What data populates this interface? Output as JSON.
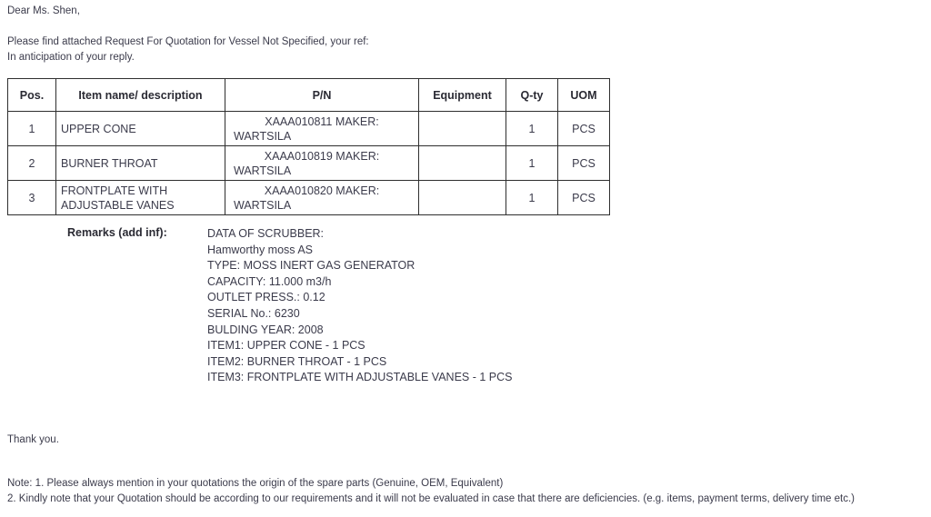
{
  "document": {
    "intro": {
      "salutation": "Dear Ms. Shen,",
      "line1": "Please find attached Request For Quotation for Vessel Not Specified, your ref:",
      "line2": "In anticipation of your reply."
    },
    "table": {
      "headers": {
        "pos": "Pos.",
        "item": "Item name/ description",
        "pn": "P/N",
        "equipment": "Equipment",
        "qty": "Q-ty",
        "uom": "UOM"
      },
      "rows": [
        {
          "pos": "1",
          "item": "UPPER CONE",
          "pn_code": "XAAA010811 MAKER:",
          "pn_maker": "WARTSILA",
          "equipment": "",
          "qty": "1",
          "uom": "PCS"
        },
        {
          "pos": "2",
          "item": "BURNER THROAT",
          "pn_code": "XAAA010819 MAKER:",
          "pn_maker": "WARTSILA",
          "equipment": "",
          "qty": "1",
          "uom": "PCS"
        },
        {
          "pos": "3",
          "item": "FRONTPLATE WITH ADJUSTABLE VANES",
          "pn_code": "XAAA010820 MAKER:",
          "pn_maker": "WARTSILA",
          "equipment": "",
          "qty": "1",
          "uom": "PCS"
        }
      ]
    },
    "remarks": {
      "label": "Remarks (add inf):",
      "lines": [
        "DATA OF SCRUBBER:",
        "Hamworthy moss AS",
        "TYPE: MOSS INERT GAS GENERATOR",
        "CAPACITY: 11.000 m3/h",
        "OUTLET PRESS.: 0.12",
        "SERIAL No.: 6230",
        "BULDING YEAR: 2008",
        "ITEM1: UPPER CONE - 1 PCS",
        "ITEM2: BURNER THROAT - 1 PCS",
        "ITEM3: FRONTPLATE WITH ADJUSTABLE VANES - 1 PCS"
      ]
    },
    "closing": "Thank you.",
    "notes": {
      "line1": "Note: 1. Please always mention in your quotations the origin of the spare parts (Genuine, OEM, Equivalent)",
      "line2": "2. Kindly note that your Quotation should be according to our requirements and it will not be evaluated in case that there are deficiencies. (e.g. items, payment terms, delivery time etc.)"
    }
  }
}
